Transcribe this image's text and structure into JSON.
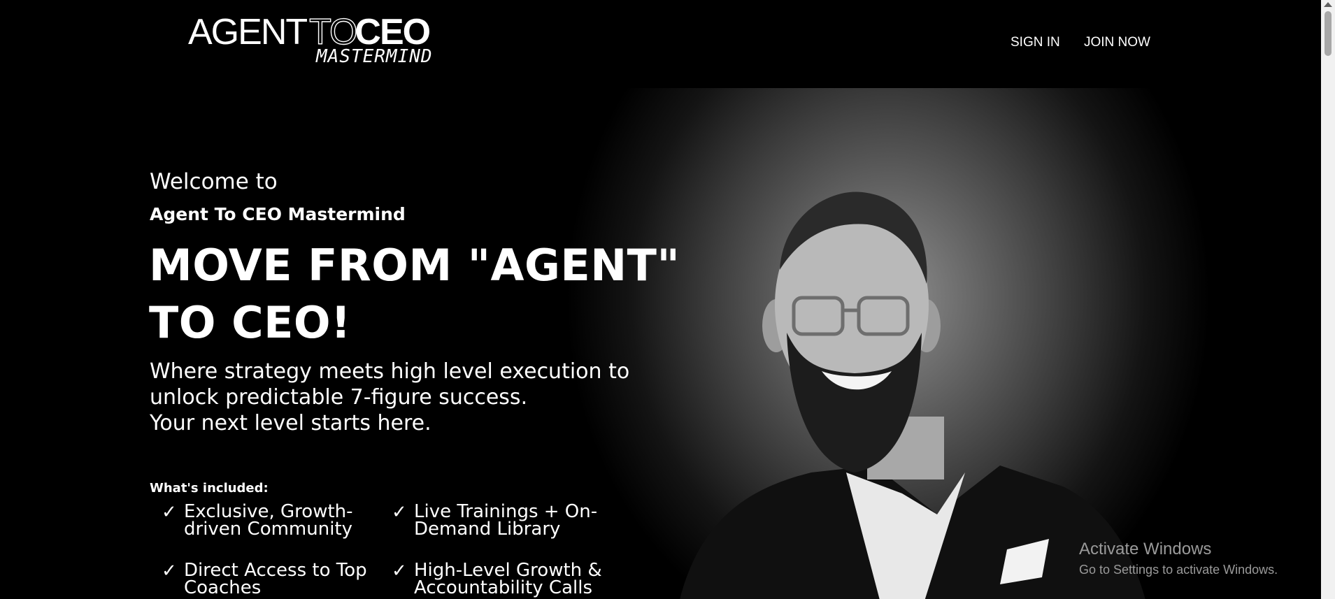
{
  "header": {
    "logo": {
      "word1": "AGENT",
      "word2": "TO",
      "word3": "CEO",
      "tagline": "MASTERMIND"
    },
    "nav": {
      "sign_in": "SIGN IN",
      "join_now": "JOIN NOW"
    }
  },
  "hero": {
    "welcome": "Welcome to",
    "subtitle": "Agent To CEO Mastermind",
    "headline": "MOVE FROM \"AGENT\" TO CEO!",
    "tagline": [
      "Where strategy meets high level execution to",
      "unlock predictable 7-figure success.",
      "Your next level starts here."
    ],
    "included_title": "What's included:",
    "check_glyph": "✓",
    "features": [
      "Exclusive, Growth-driven Community",
      "Live Trainings + On-Demand Library",
      "Direct Access to Top Coaches",
      "High-Level Growth & Accountability Calls"
    ]
  },
  "watermark": {
    "title": "Activate Windows",
    "subtitle": "Go to Settings to activate Windows."
  },
  "colors": {
    "background": "#000000",
    "text": "#ffffff",
    "watermark": "#9a9a9a"
  }
}
